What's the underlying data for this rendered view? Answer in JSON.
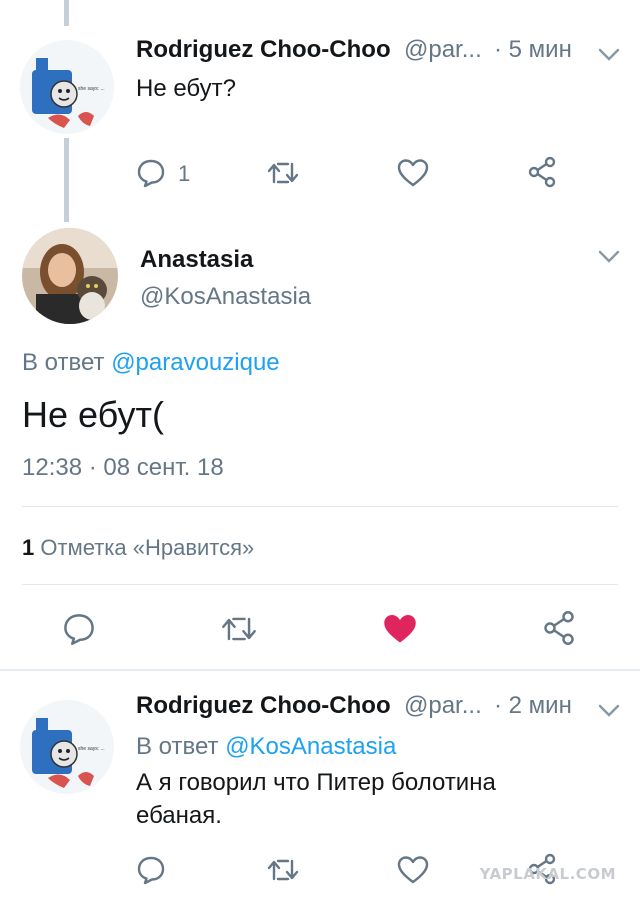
{
  "tweet1": {
    "name": "Rodriguez Choo-Choo",
    "handle": "@par...",
    "time": "· 5 мин",
    "text": "Не ебут?",
    "reply_count": "1"
  },
  "tweet2": {
    "name": "Anastasia",
    "handle": "@KosAnastasia",
    "reply_prefix": "В ответ",
    "reply_to": "@paravouzique",
    "text": "Не ебут(",
    "timestamp": "12:38 · 08 сент. 18",
    "likes_count": "1",
    "likes_label": "Отметка «Нравится»",
    "like_color": "#e0245e"
  },
  "tweet3": {
    "name": "Rodriguez Choo-Choo",
    "handle": "@par...",
    "time": "· 2 мин",
    "reply_prefix": "В ответ",
    "reply_to": "@KosAnastasia",
    "text_line1": "А я говорил что Питер болотина",
    "text_line2": "ебаная."
  },
  "avatar_caption": "she says: ...",
  "watermark": "YAPLAKAL.COM",
  "colors": {
    "accent": "#1da1f2",
    "muted": "#657786",
    "icon": "#657786",
    "like": "#e0245e"
  }
}
